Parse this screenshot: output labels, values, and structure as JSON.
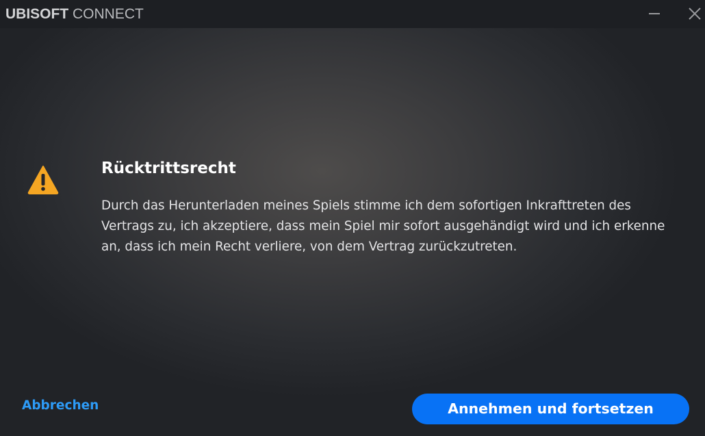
{
  "window": {
    "brand_bold": "UBISOFT",
    "brand_light": " CONNECT",
    "minimize_icon": "minimize-icon",
    "close_icon": "close-icon"
  },
  "dialog": {
    "icon": "warning-icon",
    "title": "Rücktrittsrecht",
    "message": "Durch das Herunterladen meines Spiels stimme ich dem sofortigen Inkrafttreten des Vertrags zu, ich akzeptiere, dass mein Spiel mir sofort ausgehändigt wird und ich erkenne an, dass ich mein Recht verliere, von dem Vertrag zurückzutreten."
  },
  "actions": {
    "cancel_label": "Abbrechen",
    "accept_label": "Annehmen und fortsetzen"
  },
  "colors": {
    "accent": "#0872f5",
    "link": "#2d9bf7",
    "warning": "#f5a623"
  }
}
